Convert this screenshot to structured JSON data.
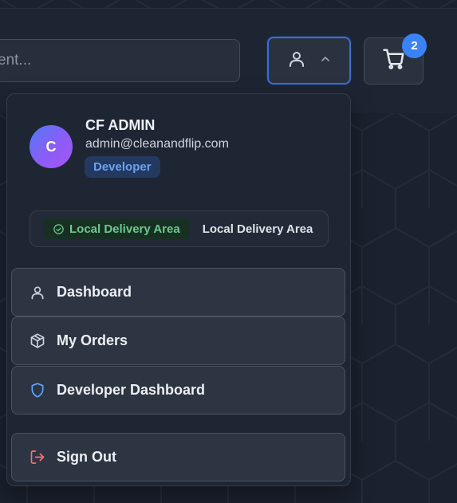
{
  "search": {
    "placeholder_visible": "ent..."
  },
  "header": {
    "cart": {
      "badge_count": "2"
    }
  },
  "user": {
    "avatar_initial": "C",
    "name": "CF ADMIN",
    "email": "admin@cleanandflip.com",
    "role": "Developer"
  },
  "delivery": {
    "pill_label": "Local Delivery Area",
    "label": "Local Delivery Area"
  },
  "menu": {
    "items": [
      {
        "label": "Dashboard",
        "icon": "user-icon"
      },
      {
        "label": "My Orders",
        "icon": "package-icon"
      },
      {
        "label": "Developer Dashboard",
        "icon": "shield-icon"
      }
    ],
    "sign_out": {
      "label": "Sign Out",
      "icon": "log-out-icon"
    }
  },
  "colors": {
    "accent": "#3b82f6",
    "role_badge_text": "#6aa3f4",
    "delivery_green": "#6cc98d",
    "shield_blue": "#60a5fa",
    "sign_out_red": "#f87171"
  }
}
